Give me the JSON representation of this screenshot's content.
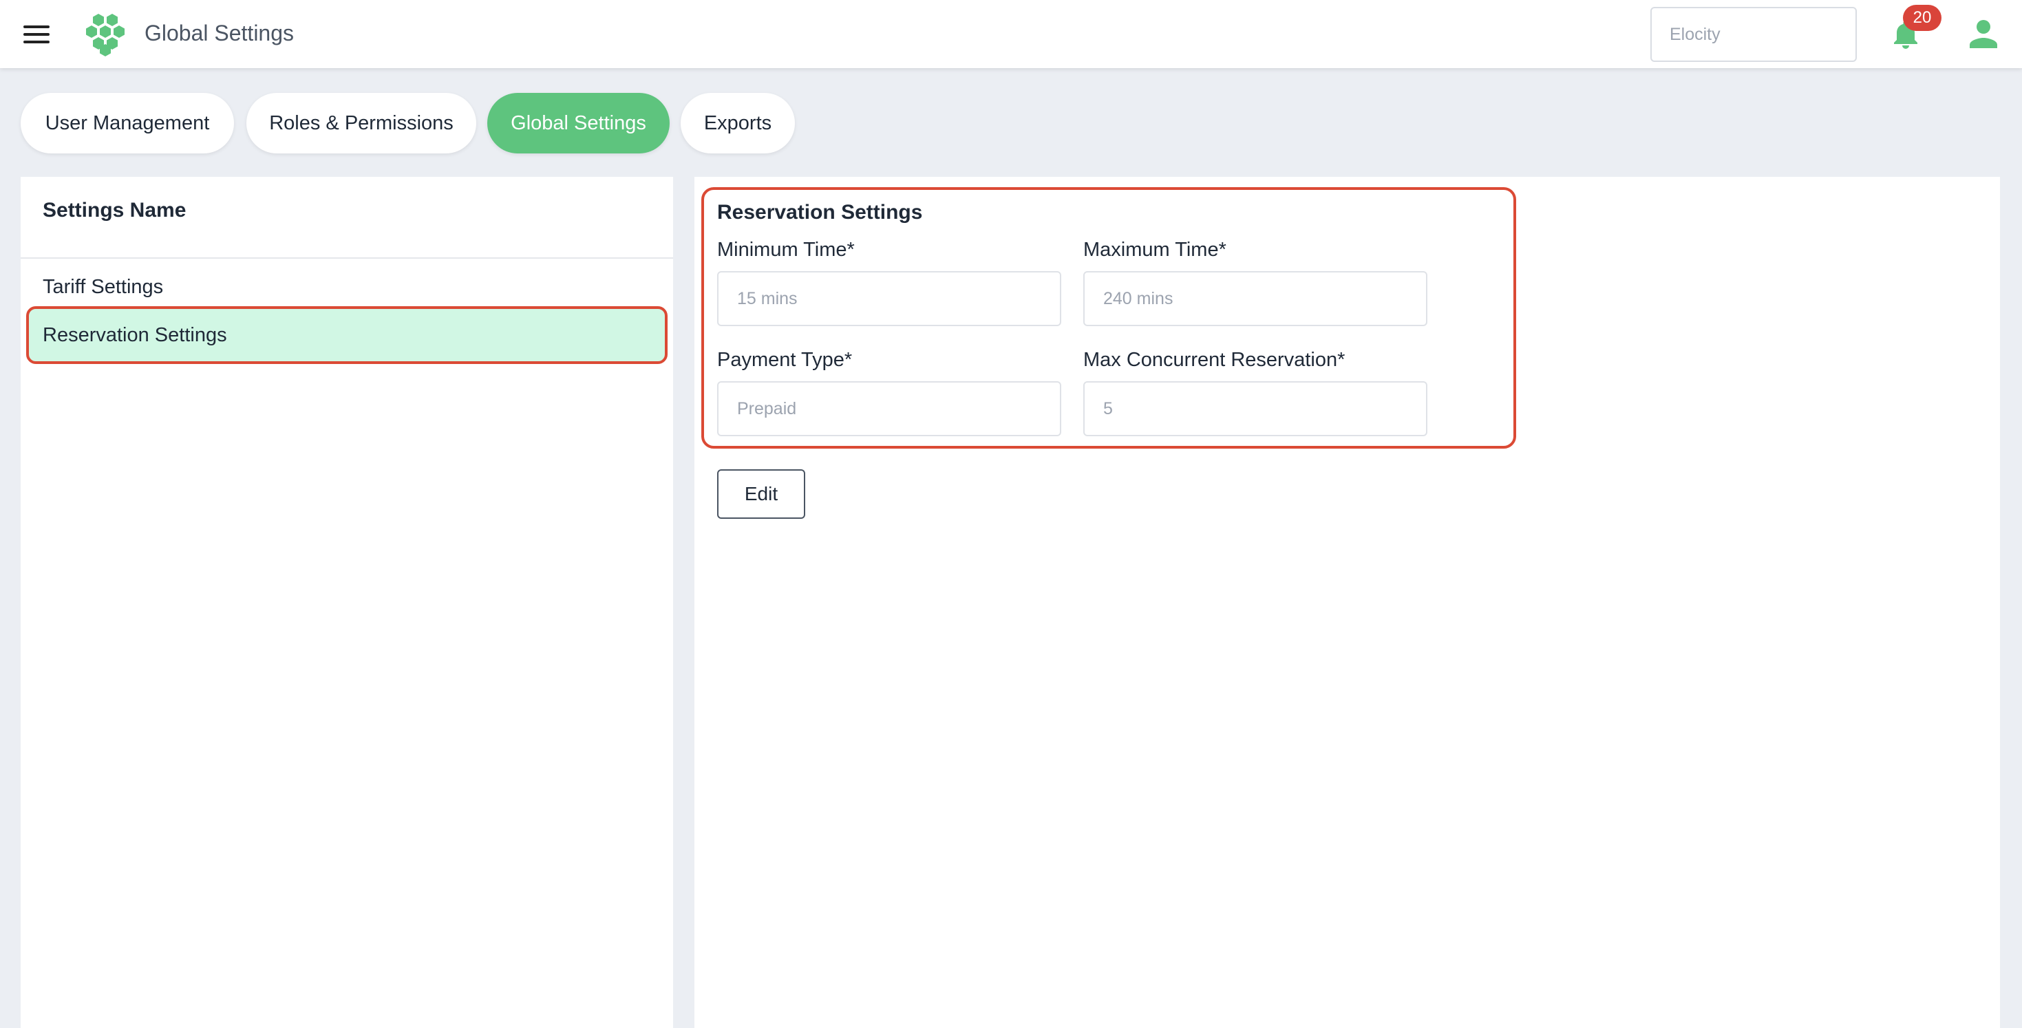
{
  "header": {
    "title": "Global Settings",
    "search_value": "Elocity",
    "notification_count": "20",
    "icons": [
      "menu-icon",
      "logo-icon",
      "bell-icon",
      "user-icon"
    ],
    "accent_color": "#5ec47e",
    "badge_color": "#d9443a"
  },
  "tabs": [
    {
      "label": "User Management",
      "active": false
    },
    {
      "label": "Roles & Permissions",
      "active": false
    },
    {
      "label": "Global Settings",
      "active": true
    },
    {
      "label": "Exports",
      "active": false
    }
  ],
  "settings_list": {
    "header": "Settings Name",
    "items": [
      {
        "label": "Tariff Settings",
        "selected": false
      },
      {
        "label": "Reservation Settings",
        "selected": true
      }
    ]
  },
  "reservation": {
    "title": "Reservation Settings",
    "min_time_label": "Minimum Time*",
    "min_time_value": "15 mins",
    "max_time_label": "Maximum Time*",
    "max_time_value": "240 mins",
    "payment_type_label": "Payment Type*",
    "payment_type_value": "Prepaid",
    "max_concurrent_label": "Max Concurrent Reservation*",
    "max_concurrent_value": "5",
    "edit_label": "Edit"
  }
}
